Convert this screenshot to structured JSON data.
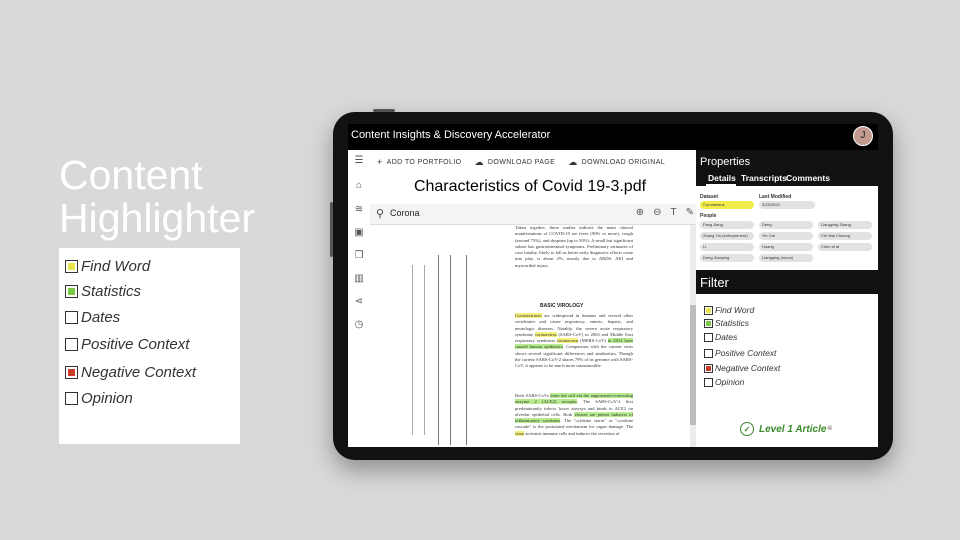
{
  "slide": {
    "title_line1": "Content",
    "title_line2": "Highlighter"
  },
  "legend": {
    "items": [
      {
        "label": "Find Word",
        "fill": "#e8e64a"
      },
      {
        "label": "Statistics",
        "fill": "#7ac943"
      },
      {
        "label": "Dates",
        "fill": ""
      },
      {
        "label": "Positive Context",
        "fill": ""
      },
      {
        "label": "Negative Context",
        "fill": "#cc3b2a"
      },
      {
        "label": "Opinion",
        "fill": ""
      }
    ]
  },
  "app": {
    "title": "Content Insights & Discovery Accelerator",
    "avatar_initial": "J"
  },
  "toolbar": {
    "add_to_portfolio": "ADD TO PORTFOLIO",
    "download_page": "DOWNLOAD PAGE",
    "download_original": "DOWNLOAD ORIGINAL"
  },
  "document": {
    "title": "Characteristics of Covid 19-3.pdf",
    "search_value": "Corona",
    "heading": "BASIC VIROLOGY",
    "para1": "Taken together, these studies indicate the main clinical manifestations of COVID-19 are fever (90% or more), cough (around 75%), and dyspnea (up to 50%). A small but significant subset has gastrointestinal symptoms. Preliminary estimates of case fatality, likely to fall as better early diagnostic efforts come into play, is about 2%, mostly due to ARDS, AKI and myocardial injury.",
    "para2_a": "Coronaviruses",
    "para2_b": " are widespread in humans and several other vertebrates and cause respiratory, enteric, hepatic, and neurologic diseases. Notably, the severe acute respiratory syndrome ",
    "para2_c": "coronavirus",
    "para2_d": " (SARS-CoV) in 2003 and Middle East respiratory syndrome ",
    "para2_e": "coronavirus",
    "para2_f": " (MERS-CoV) ",
    "para2_g": "in 2012 have caused human epidemics",
    "para2_h": ". Comparison with the current virus shows several significant differences and similarities. Though the current SARS-CoV-2 shares 79% of its genome with SARS-CoV, it appears to be much more transmissible.",
    "para3_a": "Both SARS-CoVs ",
    "para3_b": "enter the cell via the angiotensin-converting enzyme 2 (ACE2) receptor",
    "para3_c": ". The SARS-CoV-2 first predominantly infects lower airways and binds to ACE2 on alveolar epithelial cells. Both ",
    "para3_d": "viruses are potent inducers of inflammatory cytokines",
    "para3_e": ". The \"cytokine storm\" or \"cytokine cascade\" is the postulated mechanism for organ damage. The ",
    "para3_f": "virus",
    "para3_g": " activates immune cells and induces the secretion of"
  },
  "properties": {
    "title": "Properties",
    "tabs": [
      "Details",
      "Transcripts",
      "Comments"
    ],
    "dataset_label": "Dataset",
    "dataset_value": "Coronavirus",
    "last_modified_label": "Last Modified",
    "last_modified_value": "3/15/2020",
    "people_label": "People",
    "people": [
      "Fang Jiang",
      "Deng",
      "Liangping Zhang",
      "Zhang Yin (entrepreneur)",
      "Yin Cai",
      "Chi Wai Cheung",
      "Li",
      "Huang",
      "Chen et al",
      "Deng Xiaoping",
      "Liangqing (moon)",
      ""
    ]
  },
  "filter": {
    "title": "Filter",
    "items": [
      {
        "label": "Find Word",
        "fill": "#e8e64a"
      },
      {
        "label": "Statistics",
        "fill": "#7ac943"
      },
      {
        "label": "Dates",
        "fill": ""
      },
      {
        "label": "Positive Context",
        "fill": ""
      },
      {
        "label": "Negative Context",
        "fill": "#cc3b2a"
      },
      {
        "label": "Opinion",
        "fill": ""
      }
    ],
    "badge": "Level 1 Article",
    "badge_sup": "©"
  }
}
